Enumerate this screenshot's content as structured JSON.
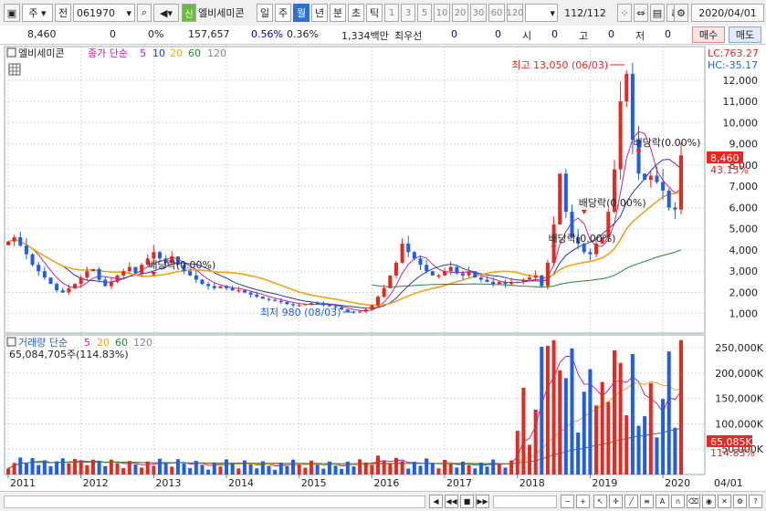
{
  "toolbar": {
    "market": "주",
    "type_btn": "전",
    "code": "061970",
    "stock_badge": "신",
    "stock_name": "엘비세미콘",
    "periods": [
      "일",
      "주",
      "월",
      "년"
    ],
    "selected_period": "월",
    "sub_periods": [
      "분",
      "초",
      "틱"
    ],
    "intervals": [
      "1",
      "3",
      "5",
      "10",
      "20",
      "30",
      "60",
      "120"
    ],
    "page_count": "112",
    "page_total": "/112",
    "date": "2020/04/01"
  },
  "infobar": {
    "price": "8,460",
    "change": "0",
    "change_pct": "0%",
    "volume": "157,657",
    "ratio1": "0.56%",
    "ratio2": "0.36%",
    "amount": "1,334백만",
    "best_label": "최우선",
    "best1": "0",
    "best2": "0",
    "open_label": "시",
    "open": "0",
    "high_label": "고",
    "high": "0",
    "low_label": "저",
    "low": "0",
    "buy_btn": "매수",
    "sell_btn": "매도"
  },
  "price_legend": {
    "name": "엘비세미콘",
    "ma_label": "종가 단순",
    "ma_periods": [
      "5",
      "10",
      "20",
      "60",
      "120"
    ]
  },
  "volume_legend": {
    "label": "거래량 단순",
    "ma_periods": [
      "5",
      "20",
      "60",
      "120"
    ],
    "value": "65,084,705주(114.83%)"
  },
  "corner": {
    "lc": "LC:763.27",
    "hc": "HC:-35.17"
  },
  "colors": {
    "up": "#e8271f",
    "down": "#1e5ee8",
    "ma5": "#c0259e",
    "ma10": "#1f3ea8",
    "ma20": "#f0a418",
    "ma60": "#1e8a38",
    "current_box": "#e8271f"
  },
  "chart_data": [
    {
      "type": "candlestick",
      "title": "엘비세미콘 월봉",
      "x_ticks": [
        "2011",
        "2012",
        "2013",
        "2014",
        "2015",
        "2016",
        "2017",
        "2018",
        "2019",
        "2020"
      ],
      "y_ticks": [
        "1,000",
        "2,000",
        "3,000",
        "4,000",
        "5,000",
        "6,000",
        "7,000",
        "8,000",
        "9,000",
        "10,000",
        "11,000",
        "12,000"
      ],
      "ylim": [
        0,
        13500
      ],
      "current_price": "8,460",
      "current_pct": "43.15%",
      "annotations": [
        {
          "text": "최고 13,050 (06/03)"
        },
        {
          "text": "최저 980 (08/03)"
        },
        {
          "text": "배당락(0.00%)"
        },
        {
          "text": "배당락(0.00%)"
        },
        {
          "text": "배당락(0.00%)"
        },
        {
          "text": "배당락(0.00%)"
        }
      ],
      "approx_monthly_closes": {
        "2011": [
          4400,
          4600,
          4200,
          3800,
          3300,
          3000,
          2700,
          2400,
          2100,
          2000,
          2200,
          2400
        ],
        "2012": [
          2700,
          3000,
          3100,
          2600,
          2300,
          2500,
          2800,
          3000,
          3200,
          2900,
          3300,
          3600
        ],
        "2013": [
          3900,
          3600,
          3400,
          3700,
          3300,
          3000,
          2800,
          2600,
          2400,
          2300,
          2200,
          2300
        ],
        "2014": [
          2200,
          2100,
          2100,
          2000,
          1900,
          1800,
          1700,
          1650,
          1600,
          1550,
          1450,
          1400
        ],
        "2015": [
          1400,
          1450,
          1500,
          1450,
          1400,
          1350,
          1300,
          1200,
          1100,
          1050,
          1100,
          1200
        ],
        "2016": [
          1400,
          1800,
          2200,
          2800,
          3400,
          4300,
          3900,
          3600,
          3300,
          3000,
          2800,
          2800
        ],
        "2017": [
          3000,
          3200,
          2900,
          2800,
          3000,
          2700,
          2600,
          2500,
          2400,
          2500,
          2400,
          2500
        ],
        "2018": [
          2500,
          2600,
          2700,
          2800,
          2300,
          3400,
          5200,
          7600,
          5800,
          4600,
          4300,
          3900
        ],
        "2019": [
          3800,
          4300,
          4600,
          5800,
          7800,
          11000,
          12300,
          9200,
          7600,
          7300,
          7500,
          7200
        ],
        "2020": [
          6800,
          6000,
          5900,
          8460
        ]
      }
    },
    {
      "type": "bar",
      "title": "거래량",
      "y_ticks": [
        "50,000K",
        "100,000K",
        "150,000K",
        "200,000K",
        "250,000K"
      ],
      "ylim": [
        0,
        270000
      ],
      "unit": "K shares",
      "current_volume": "65,085K",
      "current_pct": "114.83%",
      "highlights": [
        {
          "period": "2018-07",
          "value": 265000
        },
        {
          "period": "2019-06",
          "value": 220000
        }
      ]
    }
  ],
  "bottom": {
    "date": "04/01"
  }
}
